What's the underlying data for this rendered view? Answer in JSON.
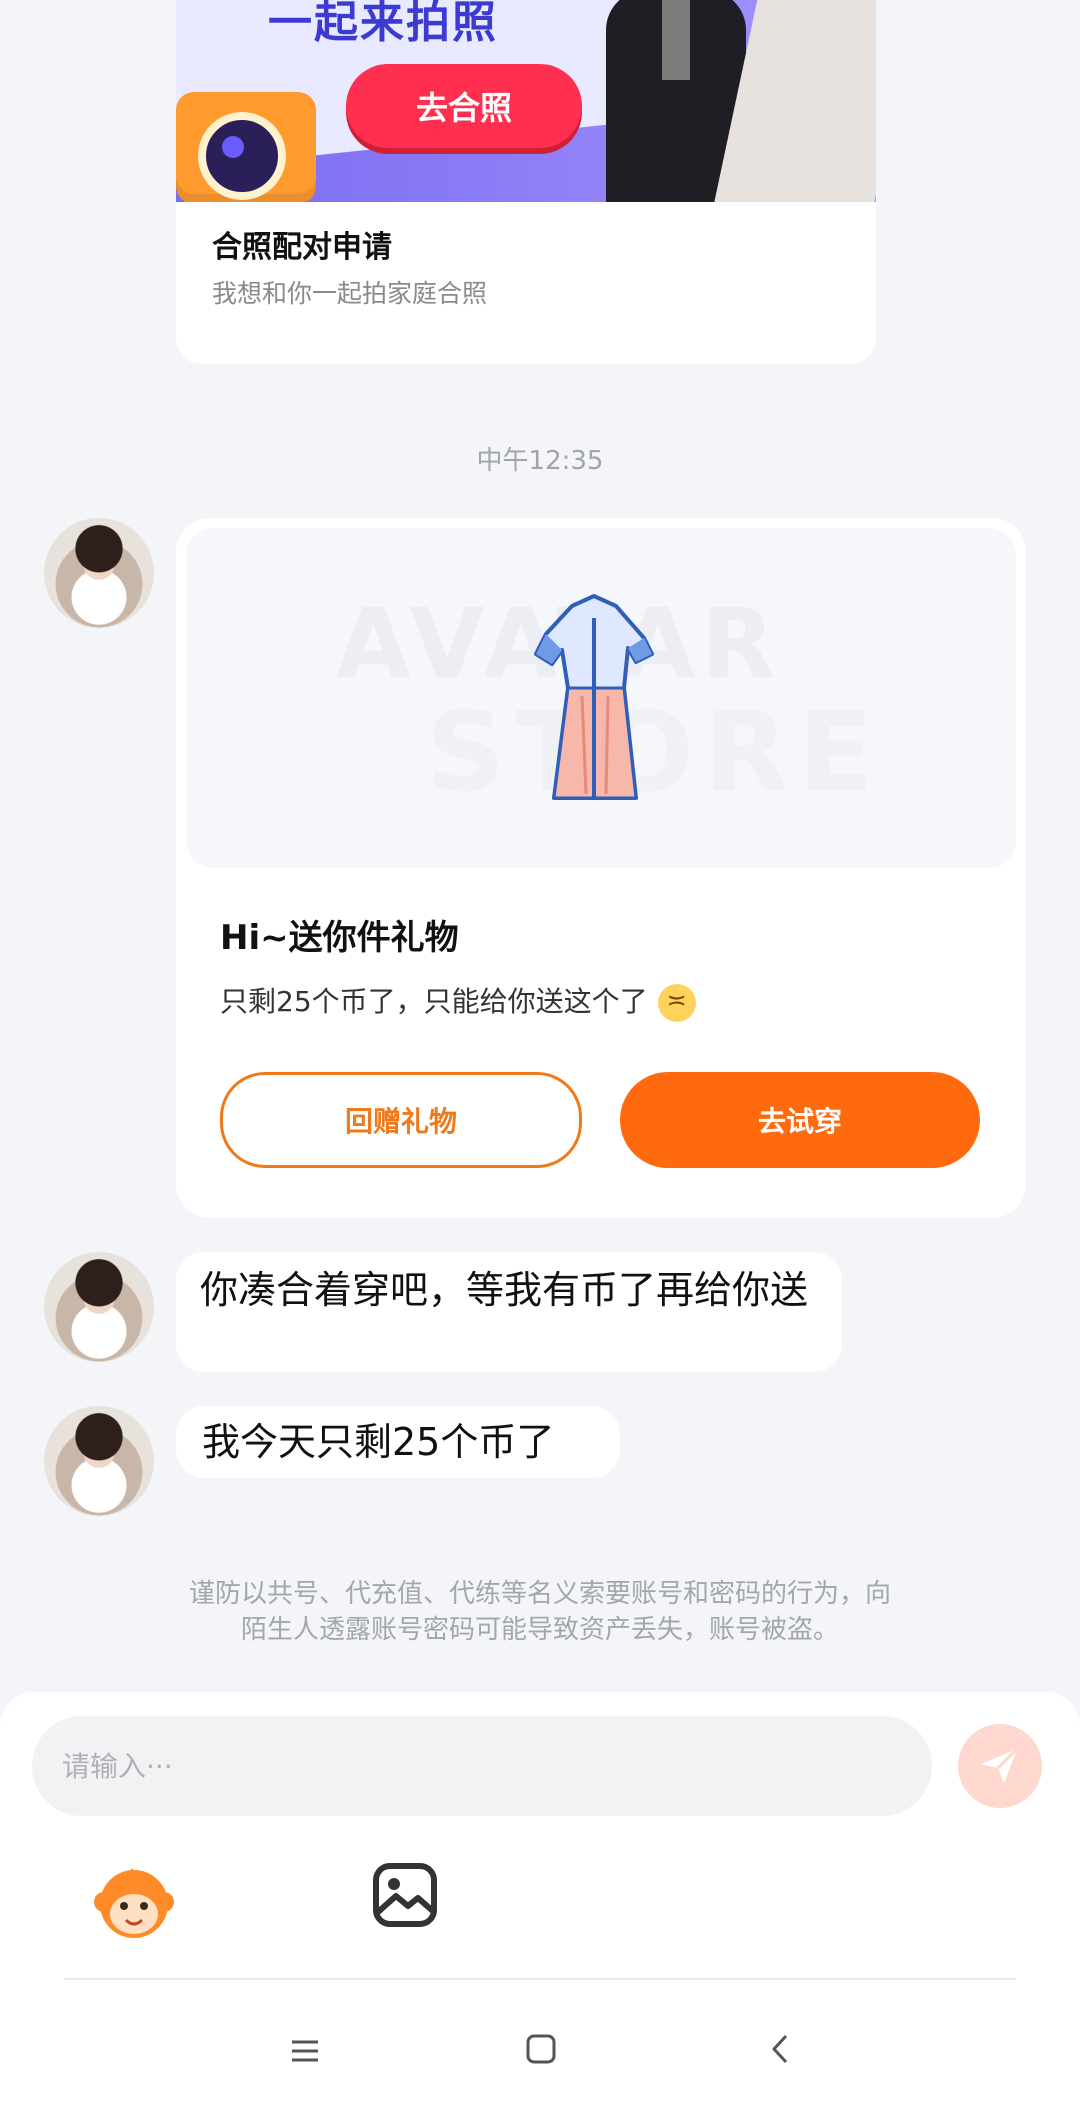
{
  "pair_card": {
    "banner_text": "一起来拍照",
    "button_label": "去合照",
    "title": "合照配对申请",
    "subtitle": "我想和你一起拍家庭合照"
  },
  "time_separator": "中午12:35",
  "gift_card": {
    "watermark_line1": "AVATAR",
    "watermark_line2": "STORE",
    "title": "Hi~送你件礼物",
    "subtitle": "只剩25个币了，只能给你送这个了",
    "emoji": "confounded-face",
    "button_return": "回赠礼物",
    "button_try": "去试穿"
  },
  "messages": [
    {
      "text": "你凑合着穿吧，等我有币了再给你送"
    },
    {
      "text": "我今天只剩25个币了"
    }
  ],
  "safety_notice": {
    "line1": "谨防以共号、代充值、代练等名义索要账号和密码的行为，向",
    "line2": "陌生人透露账号密码可能导致资产丢失，账号被盗。"
  },
  "input": {
    "placeholder": "请输入···",
    "value": ""
  },
  "icons": {
    "send": "send-icon",
    "sticker": "monkey-sticker-icon",
    "image": "image-icon",
    "nav_menu": "menu-icon",
    "nav_home": "home-icon",
    "nav_back": "back-icon"
  },
  "colors": {
    "accent": "#ff6a0f",
    "outline_button": "#f07a1a",
    "background": "#f4f5f9",
    "send_disabled": "#ffd8cf"
  }
}
